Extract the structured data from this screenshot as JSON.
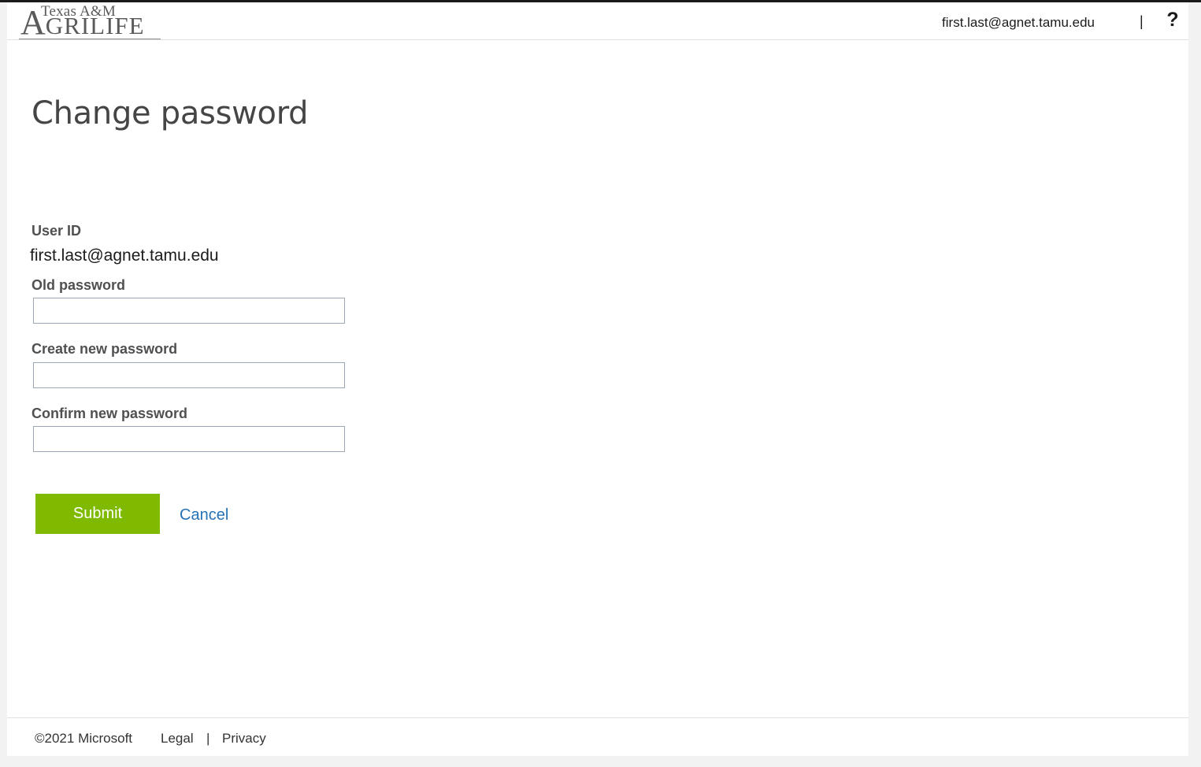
{
  "logo": {
    "line1": "Texas A&M",
    "line2_initial": "A",
    "line2_rest": "GRILIFE"
  },
  "header": {
    "user_email": "first.last@agnet.tamu.edu",
    "separator": "|",
    "help_icon": "?"
  },
  "page": {
    "title": "Change password"
  },
  "form": {
    "user_id_label": "User ID",
    "user_id_value": "first.last@agnet.tamu.edu",
    "old_password_label": "Old password",
    "old_password_value": "",
    "new_password_label": "Create new password",
    "new_password_value": "",
    "confirm_password_label": "Confirm new password",
    "confirm_password_value": "",
    "submit_label": "Submit",
    "cancel_label": "Cancel"
  },
  "footer": {
    "copyright": "©2021 Microsoft",
    "legal": "Legal",
    "separator": "|",
    "privacy": "Privacy"
  },
  "colors": {
    "submit_bg": "#7fba00",
    "link": "#2672b5",
    "input_border": "#9aa7b5"
  }
}
